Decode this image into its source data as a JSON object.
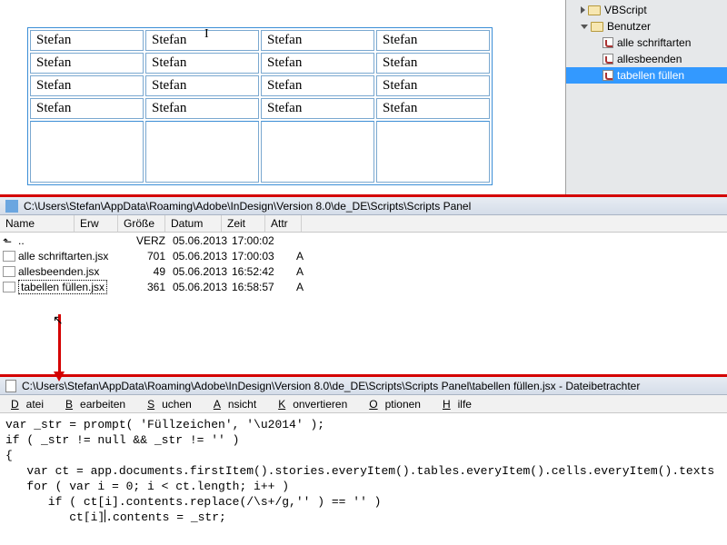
{
  "document": {
    "cell_text": "Stefan",
    "rows": 4,
    "cols": 4
  },
  "scripts_panel": {
    "nodes": [
      {
        "label": "VBScript",
        "type": "folder",
        "expanded": false,
        "depth": 1,
        "selected": false
      },
      {
        "label": "Benutzer",
        "type": "folder",
        "expanded": true,
        "depth": 1,
        "selected": false
      },
      {
        "label": "alle schriftarten",
        "type": "script",
        "depth": 3,
        "selected": false
      },
      {
        "label": "allesbeenden",
        "type": "script",
        "depth": 3,
        "selected": false
      },
      {
        "label": "tabellen füllen",
        "type": "script",
        "depth": 3,
        "selected": true
      }
    ]
  },
  "file_manager": {
    "title_path": "C:\\Users\\Stefan\\AppData\\Roaming\\Adobe\\InDesign\\Version 8.0\\de_DE\\Scripts\\Scripts Panel",
    "columns": {
      "name": "Name",
      "erw": "Erw",
      "size": "Größe",
      "date": "Datum",
      "time": "Zeit",
      "attr": "Attr"
    },
    "up_label": "..",
    "rows": [
      {
        "name": "..",
        "size": "VERZ",
        "date": "05.06.2013",
        "time": "17:00:02",
        "attr": "",
        "type": "up"
      },
      {
        "name": "alle schriftarten.jsx",
        "size": "701",
        "date": "05.06.2013",
        "time": "17:00:03",
        "attr": "A",
        "type": "file"
      },
      {
        "name": "allesbeenden.jsx",
        "size": "49",
        "date": "05.06.2013",
        "time": "16:52:42",
        "attr": "A",
        "type": "file"
      },
      {
        "name": "tabellen füllen.jsx",
        "size": "361",
        "date": "05.06.2013",
        "time": "16:58:57",
        "attr": "A",
        "type": "file",
        "selected": true
      }
    ]
  },
  "editor": {
    "title": "C:\\Users\\Stefan\\AppData\\Roaming\\Adobe\\InDesign\\Version 8.0\\de_DE\\Scripts\\Scripts Panel\\tabellen füllen.jsx - Dateibetrachter",
    "menu": {
      "datei": "Datei",
      "bearbeiten": "Bearbeiten",
      "suchen": "Suchen",
      "ansicht": "Ansicht",
      "konvertieren": "Konvertieren",
      "optionen": "Optionen",
      "hilfe": "Hilfe"
    },
    "code_lines": [
      "var _str = prompt( 'Füllzeichen', '\\u2014' );",
      "if ( _str != null && _str != '' )",
      "{",
      "   var ct = app.documents.firstItem().stories.everyItem().tables.everyItem().cells.everyItem().texts",
      "   for ( var i = 0; i < ct.length; i++ )",
      "      if ( ct[i].contents.replace(/\\s+/g,'' ) == '' )",
      "         ct[i].contents = _str;",
      "}"
    ],
    "caret_line": 6,
    "caret_col": 14
  }
}
